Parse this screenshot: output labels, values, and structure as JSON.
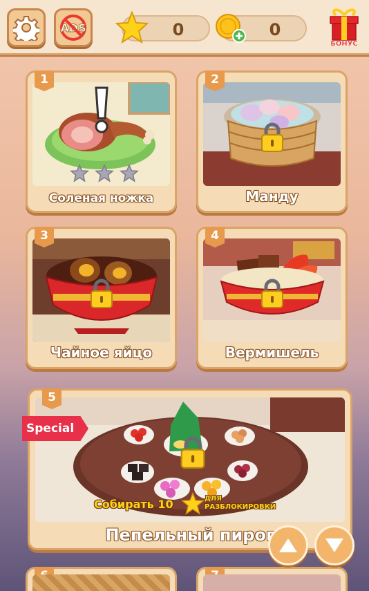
{
  "topbar": {
    "settings_icon": "gear-icon",
    "ads_icon": "no-ads-icon",
    "stars": "0",
    "coins": "0",
    "bonus_label": "БОНУС"
  },
  "levels": [
    {
      "num": "1",
      "title": "Соленая ножка",
      "stars_max": 3,
      "stars_earned": 0,
      "locked": false,
      "new": true
    },
    {
      "num": "2",
      "title": "Манду",
      "locked": true
    },
    {
      "num": "3",
      "title": "Чайное яйцо",
      "locked": true
    },
    {
      "num": "4",
      "title": "Вермишель",
      "locked": true
    },
    {
      "num": "5",
      "title": "Пепельный пирог",
      "locked": true,
      "badge": "Special",
      "unlock_text": "Собирать 10",
      "unlock_sub": "ДЛЯ РАЗБЛОКИРОВКИ"
    },
    {
      "num": "6"
    },
    {
      "num": "7"
    }
  ],
  "nav": {
    "up_icon": "arrow-up-icon",
    "down_icon": "arrow-down-icon"
  },
  "colors": {
    "accent": "#e79a4c",
    "special": "#e8304a",
    "gold": "#ffd21a"
  }
}
